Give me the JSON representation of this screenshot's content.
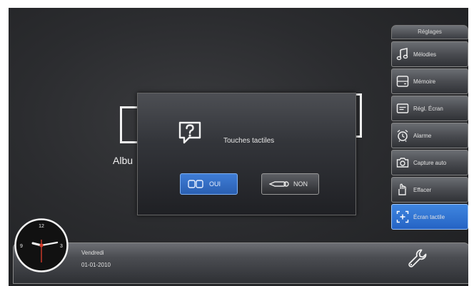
{
  "album": {
    "label": "Albu"
  },
  "modal": {
    "title": "Touches tactiles",
    "buttons": {
      "yes": "OUI",
      "no": "NON"
    },
    "yes_selected": true
  },
  "sidebar": {
    "header": "Réglages",
    "items": [
      {
        "label": "Mélodies",
        "icon": "music-note-icon"
      },
      {
        "label": "Mémoire",
        "icon": "memory-card-icon"
      },
      {
        "label": "Régl. Écran",
        "icon": "screen-settings-icon"
      },
      {
        "label": "Alarme",
        "icon": "alarm-clock-icon"
      },
      {
        "label": "Capture auto",
        "icon": "camera-icon"
      },
      {
        "label": "Effacer",
        "icon": "trash-hand-icon"
      },
      {
        "label": "Écran tactile",
        "icon": "touch-screen-icon",
        "active": true
      }
    ]
  },
  "status": {
    "day": "Vendredi",
    "date": "01-01-2010"
  },
  "clock": {
    "numerals": {
      "twelve": "12",
      "three": "3",
      "nine": "9"
    }
  },
  "colors": {
    "accent": "#2e6fd0",
    "background": "#2b2c2f"
  }
}
